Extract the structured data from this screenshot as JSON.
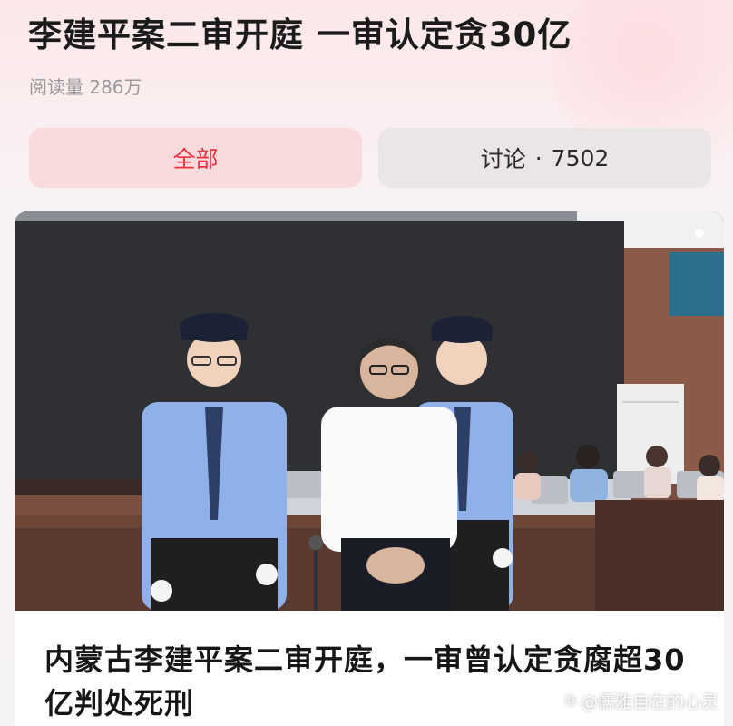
{
  "topic": {
    "title": "李建平案二审开庭 一审认定贪30亿",
    "read_count": "阅读量 286万"
  },
  "tabs": [
    {
      "label": "全部",
      "active": true
    },
    {
      "label": "讨论",
      "count": "7502",
      "separator": "·",
      "active": false
    }
  ],
  "article": {
    "photo_icon": "courtroom-photo",
    "title": "内蒙古李建平案二审开庭，一审曾认定贪腐超30亿判处死刑"
  },
  "watermark": {
    "icon": "paw-icon",
    "text": "@儒雅自在的心灵"
  },
  "colors": {
    "accent": "#e6323f",
    "active_tab_bg": "#f9dadd",
    "inactive_tab_bg": "#eae6e7"
  }
}
